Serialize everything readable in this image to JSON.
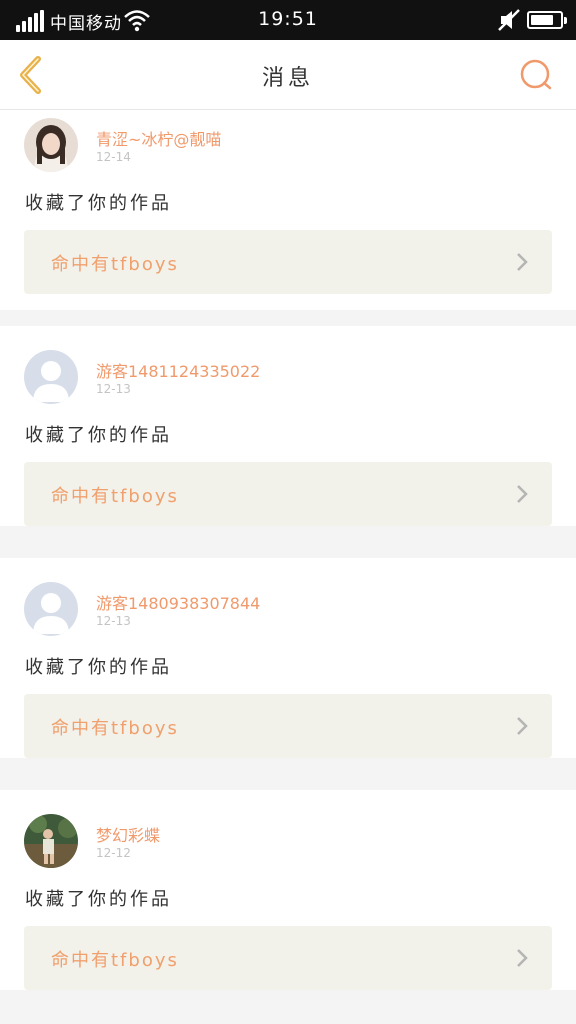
{
  "status_bar": {
    "carrier": "中国移动",
    "time": "19:51",
    "battery_level": 0.8,
    "icons": [
      "signal-icon",
      "wifi-icon",
      "mute-icon",
      "battery-icon"
    ]
  },
  "header": {
    "title": "消息",
    "back_icon": "back-chevron-icon",
    "search_icon": "search-icon"
  },
  "colors": {
    "accent": "#f09a6c",
    "back_icon": "#e8b14a",
    "card_bg": "#f2f1ea"
  },
  "notifications": [
    {
      "username": "青涩~冰柠@靓喵",
      "date": "12-14",
      "action": "收藏了你的作品",
      "work_title": "命中有tfboys",
      "avatar": "photo-avatar-girl"
    },
    {
      "username": "游客1481124335022",
      "date": "12-13",
      "action": "收藏了你的作品",
      "work_title": "命中有tfboys",
      "avatar": "default-avatar"
    },
    {
      "username": "游客1480938307844",
      "date": "12-13",
      "action": "收藏了你的作品",
      "work_title": "命中有tfboys",
      "avatar": "default-avatar"
    },
    {
      "username": "梦幻彩蝶",
      "date": "12-12",
      "action": "收藏了你的作品",
      "work_title": "命中有tfboys",
      "avatar": "photo-avatar-child"
    }
  ]
}
